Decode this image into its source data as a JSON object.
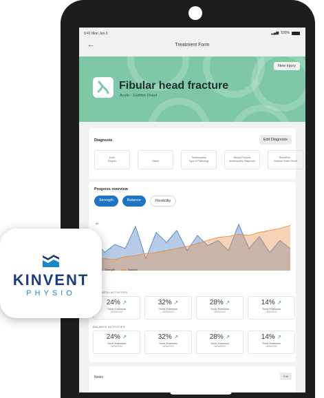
{
  "status": {
    "time": "9:41  Mon Jun 3",
    "battery": "100%"
  },
  "nav": {
    "title": "Treatment Form",
    "back_icon": "arrow-left-icon"
  },
  "hero": {
    "badge": "New Injury",
    "title": "Fibular head fracture",
    "subtitle": "Acute - Sudden Onset",
    "bg_color": "#7ec8a6"
  },
  "diagnosis": {
    "title": "Diagnosis",
    "edit_label": "Edit Diagnosis",
    "items": [
      {
        "line1": "Knee",
        "line2": "Region"
      },
      {
        "line1": "-",
        "line2": "Tissue"
      },
      {
        "line1": "Tendinopathy",
        "line2": "Type of Pathology"
      },
      {
        "line1": "Biceps Femoris",
        "line2": "tendinopathy Diagnosis"
      },
      {
        "line1": "Repetitive -",
        "line2": "Gradual Onset Onset"
      }
    ]
  },
  "progress": {
    "title": "Progress overview",
    "tabs": [
      {
        "label": "Strength",
        "active": true
      },
      {
        "label": "Balance",
        "active": true
      },
      {
        "label": "Flexibility",
        "active": false
      }
    ],
    "y_tick": "50",
    "legend": [
      "Strength",
      "Balance"
    ],
    "colors": {
      "strength": "#5b8ccb",
      "balance": "#e8914a"
    }
  },
  "chart_data": {
    "type": "area",
    "x": [
      1,
      2,
      3,
      4,
      5,
      6,
      7,
      8,
      9,
      10,
      11,
      12,
      13,
      14,
      15,
      16,
      17,
      18,
      19,
      20
    ],
    "series": [
      {
        "name": "Strength",
        "values": [
          30,
          18,
          26,
          22,
          44,
          12,
          38,
          28,
          40,
          20,
          35,
          25,
          30,
          20,
          46,
          22,
          34,
          18,
          30,
          22
        ]
      },
      {
        "name": "Balance",
        "values": [
          10,
          12,
          11,
          14,
          15,
          17,
          18,
          20,
          22,
          24,
          27,
          30,
          33,
          34,
          36,
          35,
          38,
          40,
          42,
          45
        ]
      }
    ],
    "ylim": [
      0,
      50
    ],
    "grid": false,
    "legend": "bottom-left"
  },
  "strength": {
    "label": "STRENGTH ACTIVITIES",
    "items": [
      {
        "value": "24%",
        "name": "Trunk Extension",
        "date": "18/04/2022"
      },
      {
        "value": "32%",
        "name": "Trunk Extension",
        "date": "18/04/2022"
      },
      {
        "value": "28%",
        "name": "Trunk Extension",
        "date": "18/04/2022"
      },
      {
        "value": "14%",
        "name": "Trunk Extension",
        "date": "18/04/2022"
      }
    ]
  },
  "balance": {
    "label": "BALANCE ACTIVITIES",
    "items": [
      {
        "value": "24%",
        "name": "Trunk Extension",
        "date": "18/04/2022"
      },
      {
        "value": "32%",
        "name": "Trunk Extension",
        "date": "18/04/2022"
      },
      {
        "value": "28%",
        "name": "Trunk Extension",
        "date": "18/04/2022"
      },
      {
        "value": "14%",
        "name": "Trunk Extension",
        "date": "18/04/2022"
      }
    ]
  },
  "notes": {
    "title": "Notes",
    "edit_label": "Edit"
  },
  "logo": {
    "brand": "KINVENT",
    "sub": "PHYSIO"
  }
}
